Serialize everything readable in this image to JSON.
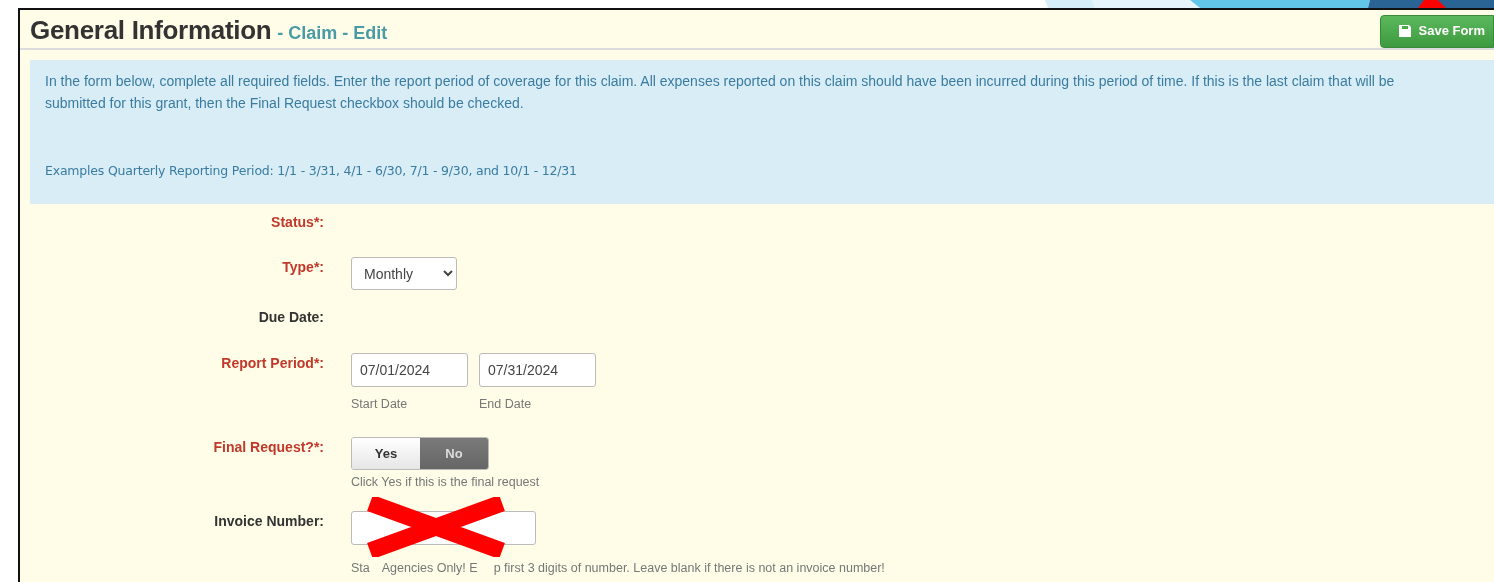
{
  "header": {
    "title": "General Information",
    "subtitle": "- Claim - Edit",
    "save_button": "Save Form"
  },
  "info": {
    "paragraph": "In the form below, complete all required fields. Enter the report period of coverage for this claim. All expenses reported on this claim should have been incurred during this period of time. If this is the last claim that will be submitted for this grant, then the Final Request checkbox should be checked.",
    "examples": "Examples Quarterly Reporting Period: 1/1 - 3/31, 4/1 - 6/30, 7/1 - 9/30, and 10/1 - 12/31"
  },
  "fields": [
    {
      "kind": "empty",
      "label": "Status*:",
      "required": true
    },
    {
      "kind": "select",
      "label": "Type*:",
      "required": true,
      "value": "Monthly"
    },
    {
      "kind": "empty",
      "label": "Due Date:",
      "required": false
    },
    {
      "kind": "daterange",
      "label": "Report Period*:",
      "required": true,
      "start": "07/01/2024",
      "end": "07/31/2024",
      "start_caption": "Start Date",
      "end_caption": "End Date"
    },
    {
      "kind": "toggle",
      "label": "Final Request?*:",
      "required": true,
      "options": [
        {
          "label": "Yes",
          "selected": false
        },
        {
          "label": "No",
          "selected": true
        }
      ],
      "hint": "Click Yes if this is the final request"
    },
    {
      "kind": "text",
      "label": "Invoice Number:",
      "required": false,
      "hint_parts": [
        "Sta",
        "Agencies Only! E",
        "p first 3 digits of number. Leave blank if there is not an invoice number!"
      ]
    }
  ]
}
